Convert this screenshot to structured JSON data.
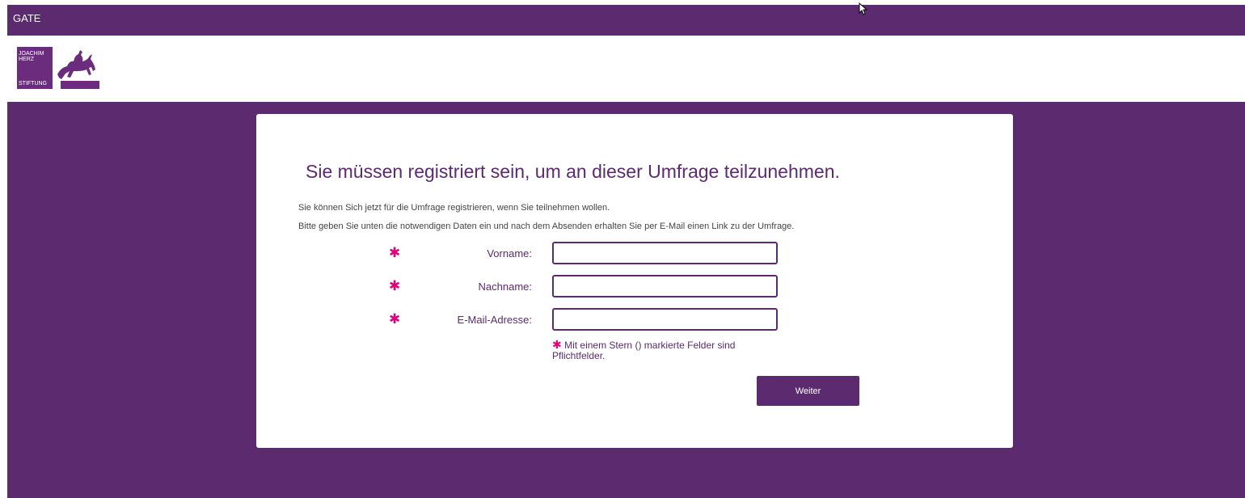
{
  "app": {
    "title": "GATE"
  },
  "logo": {
    "line1": "JOACHIM",
    "line2": "HERZ",
    "line3": "STIFTUNG"
  },
  "form": {
    "heading": "Sie müssen registriert sein, um an dieser Umfrage teilzunehmen.",
    "intro": "Sie können Sich jetzt für die Umfrage registrieren, wenn Sie teilnehmen wollen.",
    "instructions": "Bitte geben Sie unten die notwendigen Daten ein und nach dem Absenden erhalten Sie per E-Mail einen Link zu der Umfrage.",
    "required_star": "✱",
    "fields": [
      {
        "label": "Vorname:",
        "value": ""
      },
      {
        "label": "Nachname:",
        "value": ""
      },
      {
        "label": "E-Mail-Adresse:",
        "value": ""
      }
    ],
    "required_note": "Mit einem Stern () markierte Felder sind Pflichtfelder.",
    "submit_label": "Weiter"
  },
  "colors": {
    "brand_purple": "#5c2a6e",
    "required_magenta": "#e0007a",
    "card_background": "#ffffff"
  },
  "icons": {
    "logo_horse": "horse-rider-icon",
    "required": "asterisk-icon",
    "cursor": "mouse-cursor-icon"
  }
}
